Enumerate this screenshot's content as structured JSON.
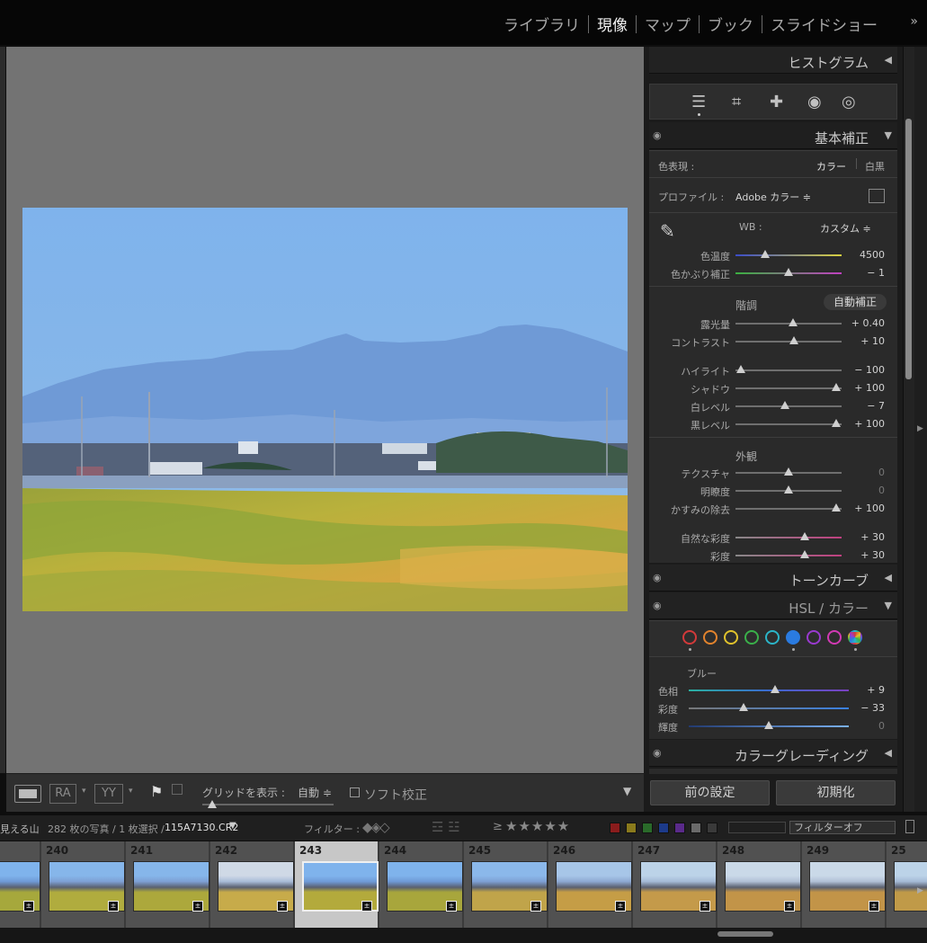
{
  "modules": {
    "items": [
      "ライブラリ",
      "現像",
      "マップ",
      "ブック",
      "スライドショー"
    ],
    "active": "現像",
    "more": "»"
  },
  "toolbar": {
    "ra": "RA",
    "yy": "YY",
    "grid_label": "グリッドを表示 :",
    "grid_value": "自動 ≑",
    "soft_proof": "ソフト校正"
  },
  "panels": {
    "histogram": "ヒストグラム",
    "basic": "基本補正",
    "tone_curve": "トーンカーブ",
    "hsl": "HSL / カラー",
    "color_grading": "カラーグレーディング"
  },
  "basic": {
    "treatment_label": "色表現 :",
    "treatment_color": "カラー",
    "treatment_bw": "白黒",
    "profile_label": "プロファイル :",
    "profile_value": "Adobe カラー ≑",
    "wb_label": "WB :",
    "wb_value": "カスタム ≑",
    "tone_label": "階調",
    "auto_button": "自動補正",
    "presence_label": "外観",
    "sliders": [
      {
        "label": "色温度",
        "value": "4500",
        "pos": 0.28
      },
      {
        "label": "色かぶり補正",
        "value": "− 1",
        "pos": 0.5
      },
      {
        "label": "露光量",
        "value": "+ 0.40",
        "pos": 0.54
      },
      {
        "label": "コントラスト",
        "value": "+ 10",
        "pos": 0.55
      },
      {
        "label": "ハイライト",
        "value": "− 100",
        "pos": 0.05
      },
      {
        "label": "シャドウ",
        "value": "+ 100",
        "pos": 0.95
      },
      {
        "label": "白レベル",
        "value": "− 7",
        "pos": 0.47
      },
      {
        "label": "黒レベル",
        "value": "+ 100",
        "pos": 0.95
      },
      {
        "label": "テクスチャ",
        "value": "0",
        "pos": 0.5
      },
      {
        "label": "明瞭度",
        "value": "0",
        "pos": 0.5
      },
      {
        "label": "かすみの除去",
        "value": "+ 100",
        "pos": 0.95
      },
      {
        "label": "自然な彩度",
        "value": "+ 30",
        "pos": 0.65
      },
      {
        "label": "彩度",
        "value": "+ 30",
        "pos": 0.65
      }
    ]
  },
  "hsl": {
    "channel": "ブルー",
    "sliders": [
      {
        "label": "色相",
        "value": "+ 9",
        "pos": 0.54
      },
      {
        "label": "彩度",
        "value": "− 33",
        "pos": 0.34
      },
      {
        "label": "輝度",
        "value": "0",
        "pos": 0.5
      }
    ],
    "colors": [
      "#d23a3a",
      "#e2832d",
      "#e0c22c",
      "#3ab04a",
      "#2bb5c8",
      "#2a7be0",
      "#9a3ad0",
      "#d23ab4",
      "multi"
    ]
  },
  "buttons": {
    "previous": "前の設定",
    "reset": "初期化"
  },
  "filmstrip": {
    "source": "見える山",
    "count": "282 枚の写真 / 1 枚選択 /",
    "filename": "115A7130.CR2",
    "filter_label": "フィルター :",
    "filter_off": "フィルターオフ",
    "rating_op": "≥",
    "color_labels": [
      "#8a1c1c",
      "#8a7a1c",
      "#2a6a2a",
      "#1c3a8a",
      "#5a2a8a",
      "#6a6a6a",
      "#3a3a3a"
    ],
    "frames": [
      {
        "num": "",
        "selected": false
      },
      {
        "num": "240",
        "selected": false
      },
      {
        "num": "241",
        "selected": false
      },
      {
        "num": "242",
        "selected": false
      },
      {
        "num": "243",
        "selected": true
      },
      {
        "num": "244",
        "selected": false
      },
      {
        "num": "245",
        "selected": false
      },
      {
        "num": "246",
        "selected": false
      },
      {
        "num": "247",
        "selected": false
      },
      {
        "num": "248",
        "selected": false
      },
      {
        "num": "249",
        "selected": false
      },
      {
        "num": "25",
        "selected": false
      }
    ]
  }
}
